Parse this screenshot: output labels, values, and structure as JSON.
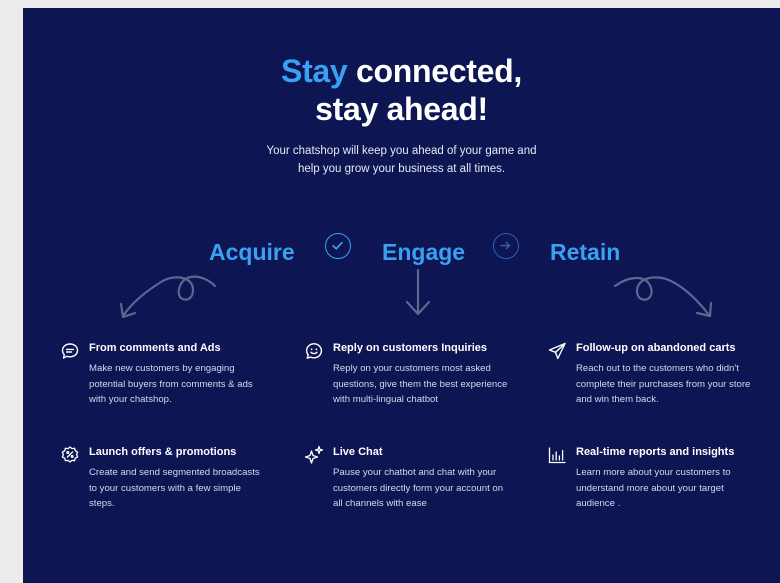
{
  "hero": {
    "title_accent": "Stay",
    "title_rest": "connected,",
    "title_line2": "stay ahead!",
    "subtitle_line1": "Your chatshop will keep you ahead of your game and",
    "subtitle_line2": "help you grow your business at all times."
  },
  "stages": [
    "Acquire",
    "Engage",
    "Retain"
  ],
  "features": [
    {
      "icon": "chat-bubble-icon",
      "title": "From comments and Ads",
      "description": "Make new customers by engaging potential buyers from comments & ads with your chatshop."
    },
    {
      "icon": "smiley-chat-icon",
      "title": "Reply on customers Inquiries",
      "description": "Reply on your customers most asked questions, give them the best experience with multi-lingual chatbot"
    },
    {
      "icon": "paper-plane-icon",
      "title": "Follow-up on abandoned carts",
      "description": "Reach out to the customers who didn't complete their purchases from your store and win them back."
    },
    {
      "icon": "discount-badge-icon",
      "title": "Launch offers & promotions",
      "description": "Create and send segmented broadcasts to your customers with a few simple steps."
    },
    {
      "icon": "sparkles-icon",
      "title": "Live Chat",
      "description": "Pause your chatbot and chat with your customers directly form your account on all channels with ease"
    },
    {
      "icon": "bar-chart-icon",
      "title": "Real-time reports and insights",
      "description": "Learn more about your customers to understand more about your target audience ."
    }
  ],
  "colors": {
    "background": "#0d1553",
    "accent": "#3aa0f3",
    "arrow": "#5f6690"
  }
}
